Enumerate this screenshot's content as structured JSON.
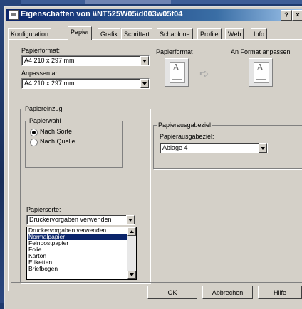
{
  "window": {
    "title": "Eigenschaften von \\\\NT525W05\\d003w05f04",
    "help_button": "?",
    "close_button": "×"
  },
  "tabs": [
    {
      "label": "Konfiguration"
    },
    {
      "label": "Papier",
      "active": true
    },
    {
      "label": "Grafik"
    },
    {
      "label": "Schriftart"
    },
    {
      "label": "Schablone"
    },
    {
      "label": "Profile"
    },
    {
      "label": "Web"
    },
    {
      "label": "Info"
    }
  ],
  "paper": {
    "format_label": "Papierformat:",
    "format_value": "A4 210 x 297 mm",
    "fit_label": "Anpassen an:",
    "fit_value": "A4 210 x 297 mm",
    "preview_format_label": "Papierformat",
    "preview_fit_label": "An Format anpassen",
    "preview_glyph": "A"
  },
  "feed": {
    "group_title": "Papiereinzug",
    "selection_title": "Papierwahl",
    "radio_by_type": "Nach Sorte",
    "radio_by_source": "Nach Quelle",
    "selected_radio": "by_type",
    "type_label": "Papiersorte:",
    "type_value": "Druckervorgaben verwenden",
    "dropdown_options": [
      "Druckervorgaben verwenden",
      "Normalpapier",
      "Feinpostpapier",
      "Folie",
      "Karton",
      "Etiketten",
      "Briefbogen"
    ],
    "highlighted_option": "Normalpapier"
  },
  "output": {
    "group_title": "Papierausgabeziel",
    "field_label": "Papierausgabeziel:",
    "field_value": "Ablage 4"
  },
  "buttons": {
    "ok": "OK",
    "cancel": "Abbrechen",
    "help": "Hilfe"
  }
}
